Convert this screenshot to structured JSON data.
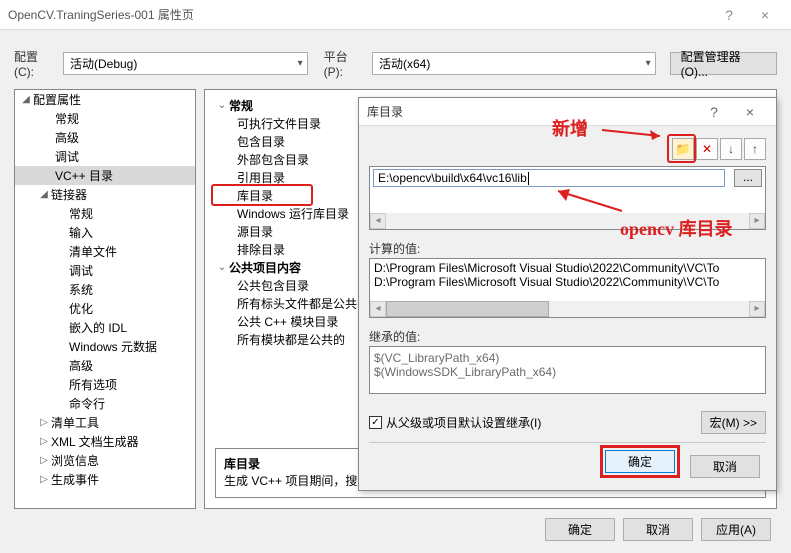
{
  "window": {
    "title": "OpenCV.TraningSeries-001 属性页",
    "help": "?",
    "close": "×"
  },
  "top": {
    "config_label": "配置(C):",
    "config_value": "活动(Debug)",
    "platform_label": "平台(P):",
    "platform_value": "活动(x64)",
    "manager": "配置管理器(O)..."
  },
  "tree": {
    "root": "配置属性",
    "items1": [
      "常规",
      "高级",
      "调试"
    ],
    "sel": "VC++ 目录",
    "linker": "链接器",
    "linker_items": [
      "常规",
      "输入",
      "清单文件",
      "调试",
      "系统",
      "优化",
      "嵌入的 IDL",
      "Windows 元数据",
      "高级",
      "所有选项",
      "命令行"
    ],
    "after": [
      "清单工具",
      "XML 文档生成器",
      "浏览信息",
      "生成事件"
    ]
  },
  "right": {
    "g1": "常规",
    "g1_items": [
      "可执行文件目录",
      "包含目录",
      "外部包含目录",
      "引用目录",
      "库目录",
      "Windows 运行库目录",
      "源目录",
      "排除目录"
    ],
    "g2": "公共项目内容",
    "g2_items": [
      "公共包含目录",
      "所有标头文件都是公共的",
      "公共 C++ 模块目录",
      "所有模块都是公共的"
    ],
    "desc_title": "库目录",
    "desc_body": "生成 VC++ 项目期间，搜索"
  },
  "modal": {
    "title": "库目录",
    "input": "E:\\opencv\\build\\x64\\vc16\\lib",
    "browse": "...",
    "calc_label": "计算的值:",
    "calc_lines": [
      "D:\\Program Files\\Microsoft Visual Studio\\2022\\Community\\VC\\To",
      "D:\\Program Files\\Microsoft Visual Studio\\2022\\Community\\VC\\To"
    ],
    "inherit_label": "继承的值:",
    "inherit_lines": [
      "$(VC_LibraryPath_x64)",
      "$(WindowsSDK_LibraryPath_x64)"
    ],
    "chk_label": "从父级或项目默认设置继承(I)",
    "macro": "宏(M) >>",
    "ok": "确定",
    "cancel": "取消"
  },
  "footer": {
    "ok": "确定",
    "cancel": "取消",
    "apply": "应用(A)"
  },
  "anno": {
    "add": "新增",
    "lib": "opencv 库目录"
  },
  "icons": {
    "new": "✧",
    "del": "✕",
    "down": "↓",
    "up": "↑"
  }
}
